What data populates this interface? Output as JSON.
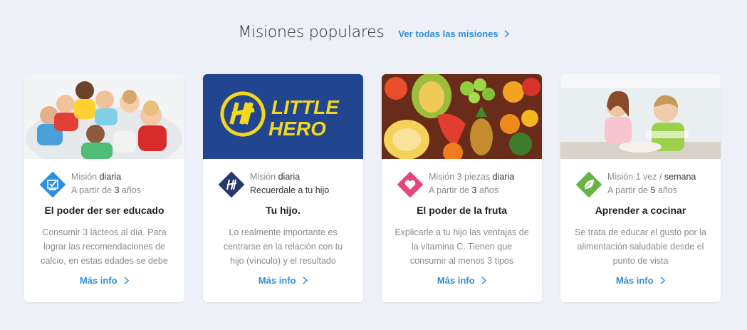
{
  "section": {
    "title": "Misiones populares",
    "see_all": "Ver todas las misiones"
  },
  "accent_color": "#2f8fd8",
  "cards": [
    {
      "image": "children-group-photo",
      "icon": "check-board-icon",
      "icon_color": "#2d8fe0",
      "line1_prefix": "Misión ",
      "line1_strong": "diaria",
      "line2_prefix": "A partir de ",
      "line2_strong": "3",
      "line2_suffix": " años",
      "title": "El poder der ser educado",
      "description": "Consumir 3 lácteos al día. Para lograr las recomendaciones de calcio, en estas edades se debe",
      "more": "Más info"
    },
    {
      "image": "little-hero-logo",
      "logo_text_1": "LITTLE",
      "logo_text_2": "HERO",
      "icon": "little-hero-icon",
      "icon_color": "#26386b",
      "line1_prefix": "Misión ",
      "line1_strong": "diaria",
      "line2_full": "Recuerdale a tu hijo",
      "title": "Tu hijo.",
      "description": "Lo realmente importante es centrarse en la relación con tu hijo (vínculo) y el resultado",
      "more": "Más info"
    },
    {
      "image": "fruits-photo",
      "icon": "heart-icon",
      "icon_color": "#e8457a",
      "line1_prefix": "Misión 3 piezas ",
      "line1_strong": "diaria",
      "line2_prefix": "A partir de ",
      "line2_strong": "3",
      "line2_suffix": " años",
      "title": "El poder de la fruta",
      "description": "Explicarle a tu hijo las ventajas de la vitamina C. Tienen que consumir al menos 3 tipos",
      "more": "Más info"
    },
    {
      "image": "kids-cooking-photo",
      "icon": "leaf-icon",
      "icon_color": "#67b446",
      "line1_prefix": "Misión 1 vez / ",
      "line1_strong": "semana",
      "line2_prefix": "A partir de ",
      "line2_strong": "5",
      "line2_suffix": " años",
      "title": "Aprender a cocinar",
      "description": "Se trata de educar el gusto por la alimentación saludable desde el punto de vista",
      "more": "Más info"
    }
  ]
}
